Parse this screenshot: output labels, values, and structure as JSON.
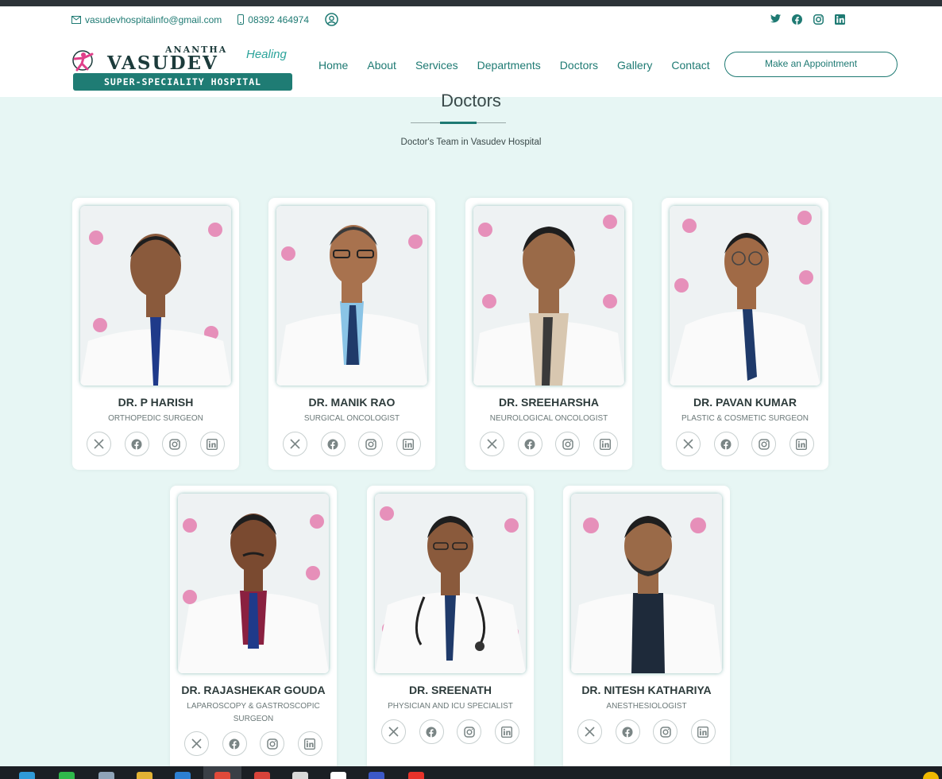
{
  "topbar": {
    "email": "vasudevhospitalinfo@gmail.com",
    "phone": "08392 464974"
  },
  "logo": {
    "line1": "ANANTHA",
    "line2": "VASUDEV",
    "tagline": "Healing",
    "bar": "SUPER-SPECIALITY HOSPITAL"
  },
  "nav": {
    "home": "Home",
    "about": "About",
    "services": "Services",
    "departments": "Departments",
    "doctors": "Doctors",
    "gallery": "Gallery",
    "contact": "Contact",
    "appointment": "Make an Appointment"
  },
  "section": {
    "title": "Doctors",
    "subtitle": "Doctor's Team in Vasudev Hospital"
  },
  "doctors": [
    {
      "name": "DR. P HARISH",
      "specialty": "ORTHOPEDIC SURGEON"
    },
    {
      "name": "DR. MANIK RAO",
      "specialty": "SURGICAL ONCOLOGIST"
    },
    {
      "name": "DR. SREEHARSHA",
      "specialty": "NEUROLOGICAL ONCOLOGIST"
    },
    {
      "name": "DR. PAVAN KUMAR",
      "specialty": "PLASTIC & COSMETIC SURGEON"
    },
    {
      "name": "DR. RAJASHEKAR GOUDA",
      "specialty": "LAPAROSCOPY & GASTROSCOPIC SURGEON"
    },
    {
      "name": "DR. SREENATH",
      "specialty": "PHYSICIAN AND ICU SPECIALIST"
    },
    {
      "name": "DR. NITESH KATHARIYA",
      "specialty": "ANESTHESIOLOGIST"
    }
  ],
  "colors": {
    "accent": "#1e7a73",
    "background": "#e7f6f4",
    "brand_pink": "#e0408a"
  },
  "icons": [
    "mail-icon",
    "phone-icon",
    "user-account-icon",
    "twitter-icon",
    "facebook-icon",
    "instagram-icon",
    "linkedin-icon",
    "x-icon"
  ]
}
